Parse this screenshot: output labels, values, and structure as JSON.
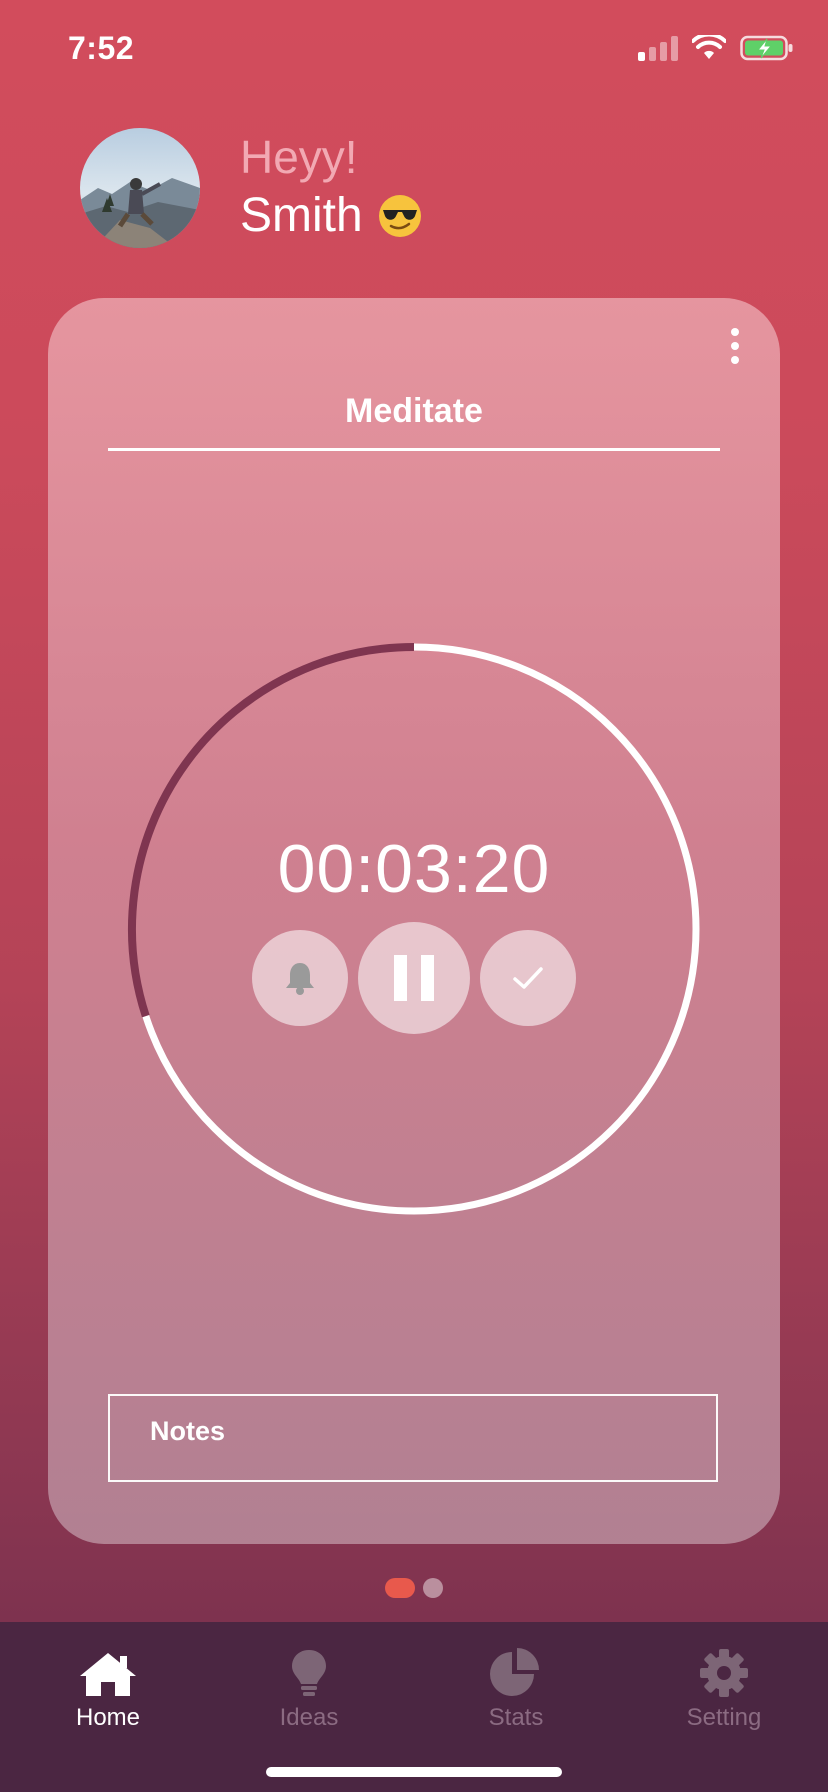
{
  "status_bar": {
    "time": "7:52",
    "icons": [
      "cellular-signal-icon",
      "wifi-icon",
      "battery-charging-icon"
    ]
  },
  "greeting": {
    "salutation": "Heyy!",
    "name": "Smith",
    "emoji": "😎"
  },
  "card": {
    "title": "Meditate",
    "timer": "00:03:20",
    "progress_elapsed_fraction": 0.3,
    "controls": {
      "bell": "bell-icon",
      "pause": "pause-icon",
      "check": "check-icon"
    },
    "notes_label": "Notes"
  },
  "pager": {
    "pages": 2,
    "active": 0
  },
  "tabs": [
    {
      "label": "Home",
      "icon": "home-icon",
      "active": true
    },
    {
      "label": "Ideas",
      "icon": "lightbulb-icon",
      "active": false
    },
    {
      "label": "Stats",
      "icon": "pie-chart-icon",
      "active": false
    },
    {
      "label": "Setting",
      "icon": "gear-icon",
      "active": false
    }
  ],
  "colors": {
    "accent": "#e8594c",
    "ring_elapsed": "#7f3550",
    "ring_remaining": "#ffffff",
    "tabbar_bg": "#4b2642"
  }
}
